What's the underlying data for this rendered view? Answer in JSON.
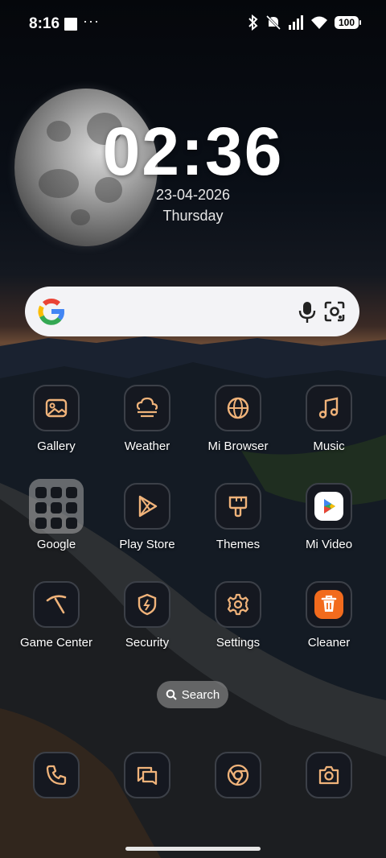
{
  "status_bar": {
    "time": "8:16",
    "more": "···",
    "battery": "100",
    "icons": [
      "bluetooth-icon",
      "mute-icon",
      "signal-icon",
      "wifi-icon",
      "battery-icon"
    ]
  },
  "clock": {
    "time": "02:36",
    "date": "23-04-2026",
    "day": "Thursday"
  },
  "search_widget": {
    "brand": "google-g-icon",
    "icons": [
      "mic-icon",
      "lens-icon"
    ]
  },
  "apps": {
    "row1": [
      {
        "label": "Gallery",
        "icon": "gallery-icon"
      },
      {
        "label": "Weather",
        "icon": "weather-icon"
      },
      {
        "label": "Mi Browser",
        "icon": "globe-icon"
      },
      {
        "label": "Music",
        "icon": "music-icon"
      }
    ],
    "row2": [
      {
        "label": "Google",
        "icon": "google-folder"
      },
      {
        "label": "Play Store",
        "icon": "play-store-icon"
      },
      {
        "label": "Themes",
        "icon": "themes-brush-icon"
      },
      {
        "label": "Mi Video",
        "icon": "mi-video-icon"
      }
    ],
    "row3": [
      {
        "label": "Game Center",
        "icon": "game-center-icon"
      },
      {
        "label": "Security",
        "icon": "security-shield-icon"
      },
      {
        "label": "Settings",
        "icon": "gear-icon"
      },
      {
        "label": "Cleaner",
        "icon": "cleaner-trash-icon"
      }
    ]
  },
  "home_search": {
    "label": "Search"
  },
  "dock": [
    "phone-icon",
    "messages-icon",
    "chrome-icon",
    "camera-icon"
  ],
  "colors": {
    "accent": "#f0b37a",
    "icon_bg": "#151820",
    "cleaner": "#f26b1d"
  }
}
